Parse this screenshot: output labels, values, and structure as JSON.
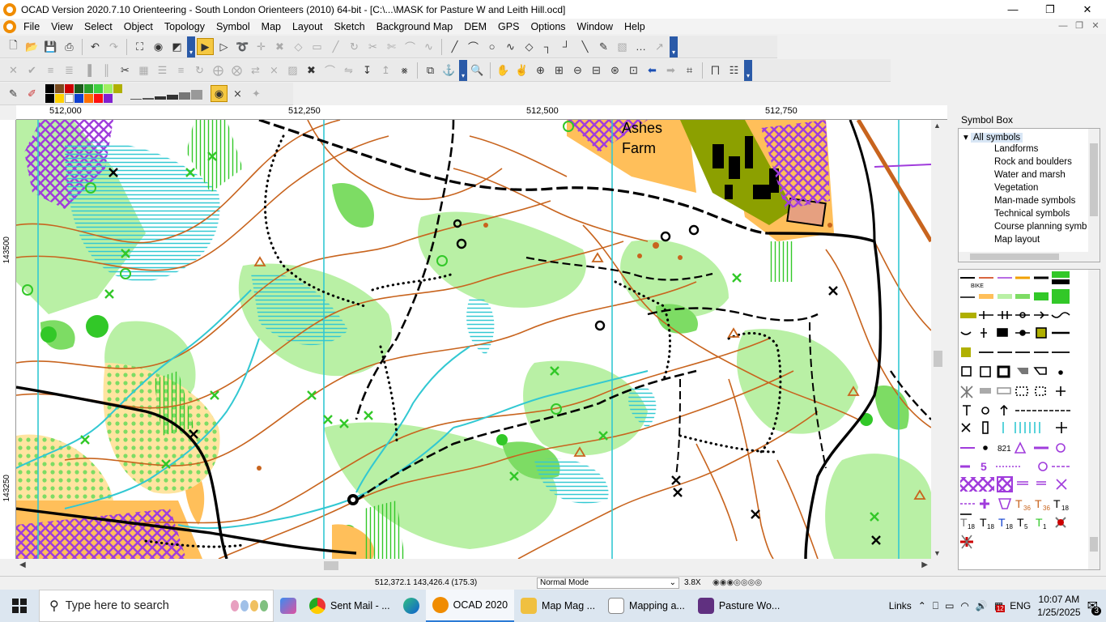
{
  "window": {
    "title": "OCAD Version 2020.7.10 Orienteering - South London Orienteers (2010) 64-bit - [C:\\...\\MASK for Pasture W and Leith Hill.ocd]"
  },
  "menu": [
    "File",
    "View",
    "Select",
    "Object",
    "Topology",
    "Symbol",
    "Map",
    "Layout",
    "Sketch",
    "Background Map",
    "DEM",
    "GPS",
    "Options",
    "Window",
    "Help"
  ],
  "ruler": {
    "top_labels": [
      "512,000",
      "512,250",
      "512,500",
      "512,750"
    ],
    "left_labels": [
      "143500",
      "143250"
    ]
  },
  "map": {
    "place_label_1": "Ashes",
    "place_label_2": "Farm"
  },
  "symbol_box": {
    "title": "Symbol Box",
    "tree_root": "All symbols",
    "tree_items": [
      "Landforms",
      "Rock and boulders",
      "Water and marsh",
      "Vegetation",
      "Man-made symbols",
      "Technical symbols",
      "Course planning symb",
      "Map layout"
    ],
    "grid_labels": [
      "BIKE",
      "821",
      "5",
      "36",
      "36",
      "18",
      "18",
      "18",
      "18",
      "5",
      "1"
    ]
  },
  "status": {
    "coords": "512,372.1    143,426.4   (175.3)",
    "mode": "Normal Mode",
    "zoom": "3.8X"
  },
  "taskbar": {
    "search_placeholder": "Type here to search",
    "apps": [
      "Sent Mail - ...",
      "OCAD 2020",
      "Map Mag ...",
      "Mapping a...",
      "Pasture Wo..."
    ],
    "links": "Links",
    "language": "ENG",
    "time": "10:07 AM",
    "date": "1/25/2025",
    "notification_count": "3",
    "calendar_badge": "12"
  },
  "colors": {
    "contour": "#c8641e",
    "vegetation_light": "#b9f0a5",
    "vegetation_mid": "#7ddc64",
    "vegetation_dark": "#32c828",
    "water": "#32c8d2",
    "open_land": "#ffbf5a",
    "olive": "#8ca000",
    "purple": "#a03cdc",
    "taskbar_bg": "#dce6f0"
  }
}
